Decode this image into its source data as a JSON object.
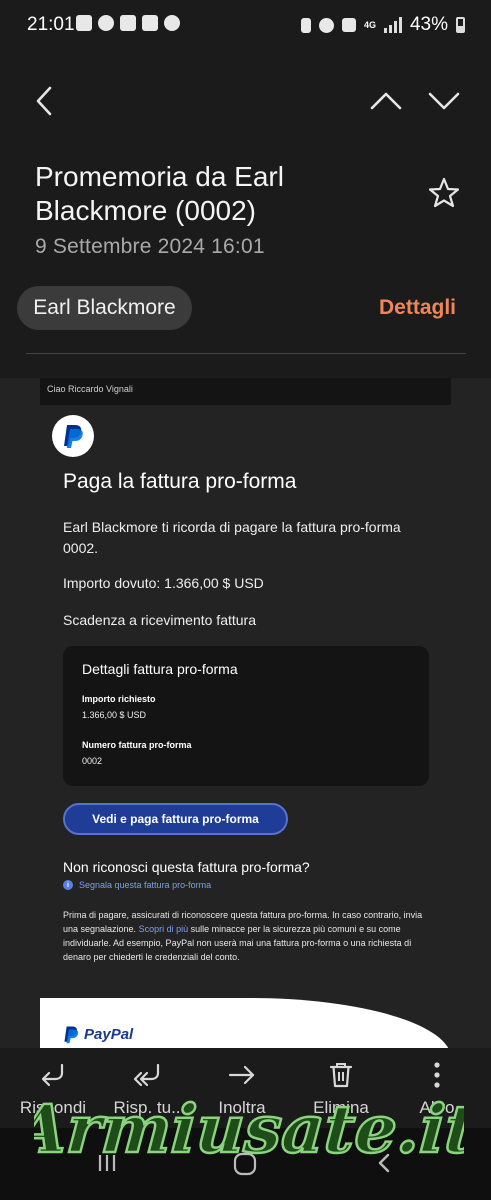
{
  "status_bar": {
    "time": "21:01",
    "network": "4G",
    "battery": "43%",
    "left_icons": [
      "youtube-icon",
      "cloud-sync-icon",
      "instagram-icon",
      "gallery-icon",
      "cloud-icon"
    ],
    "right_icons": [
      "nfc-icon",
      "alarm-icon",
      "mute-icon",
      "signal-icon",
      "battery-icon"
    ]
  },
  "header": {
    "subject": "Promemoria da Earl Blackmore (0002)",
    "date": "9 Settembre 2024  16:01",
    "sender": "Earl Blackmore",
    "details_label": "Dettagli"
  },
  "email": {
    "greeting": "Ciao Riccardo Vignali",
    "title": "Paga la fattura pro-forma",
    "paragraph1": "Earl Blackmore ti ricorda di pagare la fattura pro-forma 0002.",
    "amount_due": "Importo dovuto: 1.366,00 $ USD",
    "due_date": "Scadenza a ricevimento fattura",
    "card": {
      "title": "Dettagli fattura pro-forma",
      "label_amount": "Importo richiesto",
      "value_amount": "1.366,00 $ USD",
      "label_number": "Numero fattura pro-forma",
      "value_number": "0002"
    },
    "cta_label": "Vedi e paga fattura pro-forma",
    "question": "Non riconosci questa fattura pro-forma?",
    "report_link": "Segnala questa fattura pro-forma",
    "warning_part1": "Prima di pagare, assicurati di riconoscere questa fattura pro-forma. In caso contrario, invia una segnalazione. ",
    "warning_link": "Scopri di più",
    "warning_part2": " sulle minacce per la sicurezza più comuni e su come individuarle. Ad esempio, PayPal non userà mai una fattura pro-forma o una richiesta di denaro per chiederti le credenziali del conto.",
    "footer_brand": "PayPal"
  },
  "actions": {
    "reply": "Rispondi",
    "reply_all": "Risp. tu..",
    "forward": "Inoltra",
    "delete": "Elimina",
    "more": "Altro"
  },
  "watermark": "Armiusate.it",
  "colors": {
    "accent_orange": "#f0855a",
    "paypal_blue": "#1f3c96",
    "link_blue": "#7f9ff3",
    "watermark_green": "#2f7d2a"
  }
}
